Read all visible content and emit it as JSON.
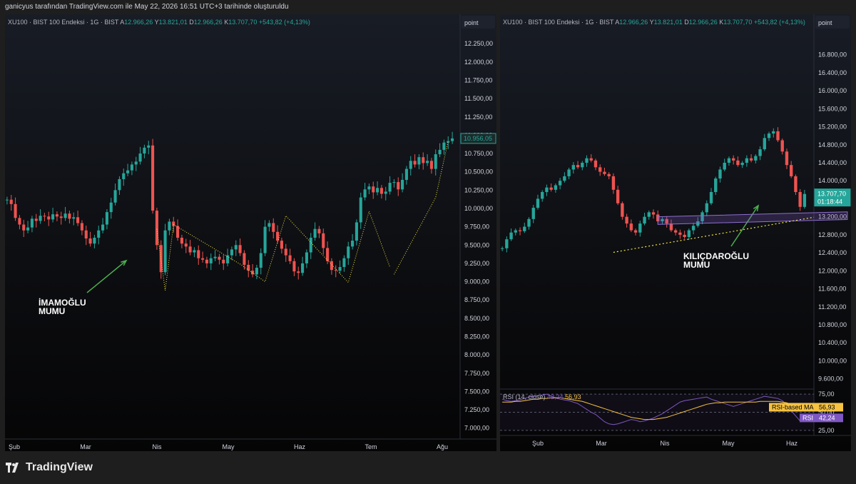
{
  "page": {
    "credit": "ganicyus tarafından TradingView.com ile May 22, 2026 16:51 UTC+3 tarihinde oluşturuldu",
    "brand": "TradingView"
  },
  "colors": {
    "up": "#26a69a",
    "down": "#ef5350",
    "annotation": "#4caf50",
    "trend": "#f5e642",
    "rsi": "#7e57c2",
    "rsi_ma": "#f5c242"
  },
  "chart_data": [
    {
      "type": "candlestick",
      "symbol_line": {
        "name": "XU100 · BIST 100 Endeksi · 1G · BIST",
        "o_label": "A",
        "o": "12.966,26",
        "h_label": "Y",
        "h": "13.821,01",
        "l_label": "D",
        "l": "12.966,26",
        "c_label": "K",
        "c": "13.707,70",
        "change": "+543,82 (+4,13%)"
      },
      "scale_label": "point",
      "y_ticks": [
        "12.250,00",
        "12.000,00",
        "11.750,00",
        "11.500,00",
        "11.250,00",
        "11.000,00",
        "10.750,00",
        "10.500,00",
        "10.250,00",
        "10.000,00",
        "9.750,00",
        "9.500,00",
        "9.250,00",
        "9.000,00",
        "8.750,00",
        "8.500,00",
        "8.250,00",
        "8.000,00",
        "7.750,00",
        "7.500,00",
        "7.250,00",
        "7.000,00"
      ],
      "ylim": [
        6900,
        12320
      ],
      "x_ticks": [
        "Şub",
        "Mar",
        "Nis",
        "May",
        "Haz",
        "Tem",
        "Ağu"
      ],
      "last_price": "10.956,05",
      "annotation": "İMAMOĞLU\nMUMU",
      "closes": [
        10120,
        10060,
        9870,
        9780,
        9700,
        9740,
        9860,
        9830,
        9900,
        9890,
        9850,
        9920,
        9890,
        9870,
        9930,
        9860,
        9880,
        9800,
        9700,
        9590,
        9520,
        9600,
        9700,
        9780,
        9950,
        10080,
        10250,
        10400,
        10480,
        10520,
        10600,
        10640,
        10750,
        10830,
        10860,
        9970,
        9500,
        9130,
        9700,
        9820,
        9760,
        9600,
        9520,
        9480,
        9400,
        9430,
        9320,
        9300,
        9250,
        9320,
        9340,
        9300,
        9250,
        9360,
        9440,
        9500,
        9390,
        9230,
        9150,
        9100,
        9190,
        9390,
        9750,
        9800,
        9680,
        9560,
        9450,
        9360,
        9280,
        9140,
        9120,
        9250,
        9400,
        9600,
        9720,
        9660,
        9460,
        9280,
        9160,
        9150,
        9200,
        9320,
        9480,
        9560,
        9810,
        10150,
        10260,
        10300,
        10220,
        10280,
        10200,
        10230,
        10350,
        10360,
        10260,
        10390,
        10540,
        10650,
        10600,
        10700,
        10620,
        10650,
        10540,
        10740,
        10800,
        10900,
        10920,
        10956
      ]
    },
    {
      "type": "candlestick",
      "symbol_line": {
        "name": "XU100 · BIST 100 Endeksi · 1G · BIST",
        "o_label": "A",
        "o": "12.966,26",
        "h_label": "Y",
        "h": "13.821,01",
        "l_label": "D",
        "l": "12.966,26",
        "c_label": "K",
        "c": "13.707,70",
        "change": "+543,82 (+4,13%)"
      },
      "scale_label": "point",
      "y_ticks": [
        "16.800,00",
        "16.400,00",
        "16.000,00",
        "15.600,00",
        "15.200,00",
        "14.800,00",
        "14.400,00",
        "14.000,00",
        "13.600,00",
        "13.200,00",
        "12.800,00",
        "12.400,00",
        "12.000,00",
        "11.600,00",
        "11.200,00",
        "10.800,00",
        "10.400,00",
        "10.000,00",
        "9.600,00"
      ],
      "ylim": [
        9420,
        17160
      ],
      "x_ticks": [
        "Şub",
        "Mar",
        "Nis",
        "May",
        "Haz"
      ],
      "last_price": "13.707,70",
      "countdown": "01:18:44",
      "annotation": "KILIÇDAROĞLU\nMUMU",
      "closes": [
        12500,
        12700,
        12850,
        12900,
        12880,
        12980,
        13150,
        13400,
        13600,
        13750,
        13850,
        13800,
        13900,
        14000,
        14100,
        14250,
        14350,
        14300,
        14400,
        14500,
        14450,
        14300,
        14200,
        14150,
        14100,
        13800,
        13500,
        13200,
        13050,
        12900,
        12850,
        13050,
        13200,
        13300,
        13250,
        13100,
        13150,
        13050,
        12900,
        12850,
        12800,
        12750,
        12900,
        13000,
        13100,
        13300,
        13500,
        13750,
        14050,
        14250,
        14400,
        14500,
        14450,
        14350,
        14400,
        14500,
        14450,
        14550,
        14700,
        14950,
        15050,
        15100,
        14900,
        14650,
        14350,
        14100,
        13750,
        13420,
        13707
      ],
      "rsi": {
        "label": "RSI (14, close)",
        "ma_value": "56,93",
        "rsi_value": "42,24",
        "ma_label": "RSI-based MA",
        "rsi_label": "RSI",
        "y_ticks": [
          "75,00",
          "50,00",
          "25,00"
        ],
        "ylim": [
          20,
          80
        ],
        "values": [
          68,
          66,
          65,
          66,
          67,
          69,
          71,
          72,
          73,
          74,
          75,
          72,
          70,
          68,
          67,
          66,
          64,
          62,
          58,
          54,
          50,
          47,
          42,
          37,
          34,
          33,
          34,
          36,
          38,
          40,
          39,
          37,
          38,
          40,
          42,
          45,
          48,
          52,
          56,
          60,
          64,
          66,
          67,
          68,
          69,
          70,
          71,
          68,
          66,
          64,
          62,
          60,
          58,
          60,
          62,
          64,
          66,
          68,
          70,
          72,
          71,
          70,
          69,
          66,
          60,
          52,
          45,
          38,
          42
        ],
        "ma": [
          64,
          64,
          64,
          65,
          65,
          66,
          67,
          68,
          68,
          69,
          69,
          70,
          70,
          70,
          69,
          68,
          67,
          66,
          65,
          63,
          61,
          59,
          57,
          55,
          53,
          51,
          49,
          47,
          45,
          43,
          42,
          41,
          40,
          40,
          40,
          41,
          42,
          43,
          45,
          47,
          49,
          51,
          53,
          55,
          57,
          59,
          61,
          62,
          63,
          63,
          64,
          64,
          64,
          64,
          64,
          64,
          64,
          64,
          65,
          65,
          65,
          65,
          65,
          64,
          63,
          61,
          59,
          58,
          57
        ]
      }
    }
  ]
}
